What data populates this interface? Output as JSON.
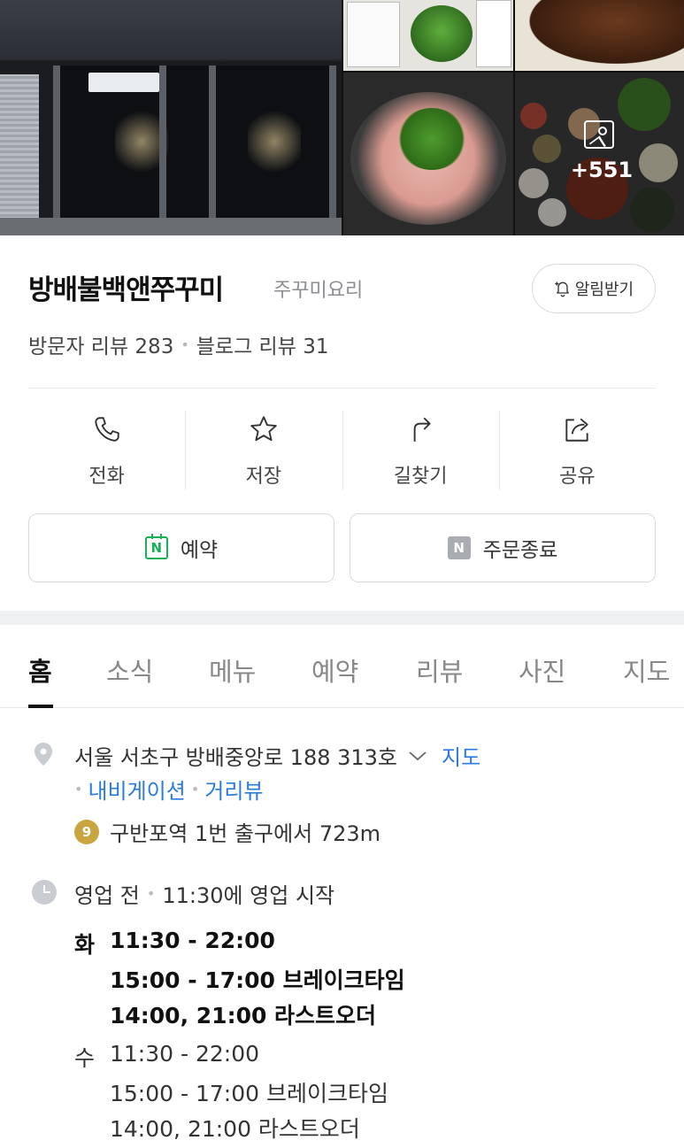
{
  "photos": {
    "more_count": "+551"
  },
  "place": {
    "name": "방배불백앤쭈꾸미",
    "category": "주꾸미요리",
    "alarm_label": "알림받기",
    "visitor_reviews": "방문자 리뷰 283",
    "blog_reviews": "블로그 리뷰 31"
  },
  "actions": [
    {
      "label": "전화",
      "icon": "phone-icon"
    },
    {
      "label": "저장",
      "icon": "star-icon"
    },
    {
      "label": "길찾기",
      "icon": "directions-icon"
    },
    {
      "label": "공유",
      "icon": "share-icon"
    }
  ],
  "booking": {
    "reserve_label": "예약",
    "order_label": "주문종료",
    "n_glyph": "N",
    "reserve_color": "#19b155"
  },
  "tabs": [
    "홈",
    "소식",
    "메뉴",
    "예약",
    "리뷰",
    "사진",
    "지도"
  ],
  "info": {
    "address": "서울 서초구 방배중앙로 188 313호",
    "map_link": "지도",
    "navigation": "내비게이션",
    "street_view": "거리뷰",
    "subway_line": "9",
    "subway_line_color": "#c8a53e",
    "station": "구반포역 1번 출구에서 723m",
    "link_color": "#2a7ae2"
  },
  "hours": {
    "status": "영업 전",
    "start_note": "11:30에 영업 시작",
    "days": [
      {
        "day": "화",
        "lines": [
          "11:30 - 22:00",
          "15:00 - 17:00 브레이크타임",
          "14:00, 21:00 라스트오더"
        ]
      },
      {
        "day": "수",
        "lines": [
          "11:30 - 22:00",
          "15:00 - 17:00 브레이크타임",
          "14:00, 21:00 라스트오더"
        ]
      }
    ]
  }
}
